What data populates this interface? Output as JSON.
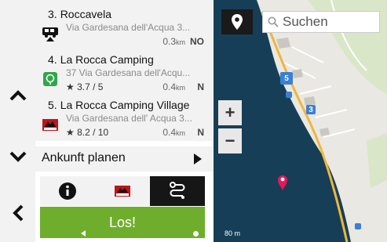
{
  "nav": {
    "up_icon": "chevron-up-icon",
    "down_icon": "chevron-down-icon",
    "back_icon": "chevron-left-icon"
  },
  "results": [
    {
      "num": "3.",
      "name": "Roccavela",
      "address": "Via Gardesana dell'Acqua 3...",
      "rating": "",
      "distance": "0.3",
      "unit": "km",
      "direction": "NO",
      "logo": "campervan-icon"
    },
    {
      "num": "4.",
      "name": "La Rocca Camping",
      "address": "37 Via Gardesana dell'Acqu...",
      "rating": "3.7 / 5",
      "distance": "0.4",
      "unit": "km",
      "direction": "N",
      "logo": "green-campsite-icon"
    },
    {
      "num": "5.",
      "name": "La Rocca Camping Village",
      "address": "Via Gardesana dell' Acqua 3...",
      "rating": "8.2 / 10",
      "distance": "0.4",
      "unit": "km",
      "direction": "N",
      "logo": "acsi-logo-icon"
    }
  ],
  "plan_label": "Ankunft planen",
  "tabs": [
    {
      "icon": "info-icon"
    },
    {
      "icon": "acsi-logo-icon"
    },
    {
      "icon": "route-icon"
    }
  ],
  "go_label": "Los!",
  "map": {
    "search_placeholder": "Suchen",
    "zoom_in": "+",
    "zoom_out": "−",
    "scale": "80 m",
    "markers": [
      "5",
      "3"
    ]
  },
  "colors": {
    "go": "#6fae2d",
    "water": "#163f57",
    "marker": "#3a7fd6",
    "pin": "#e4185a"
  }
}
